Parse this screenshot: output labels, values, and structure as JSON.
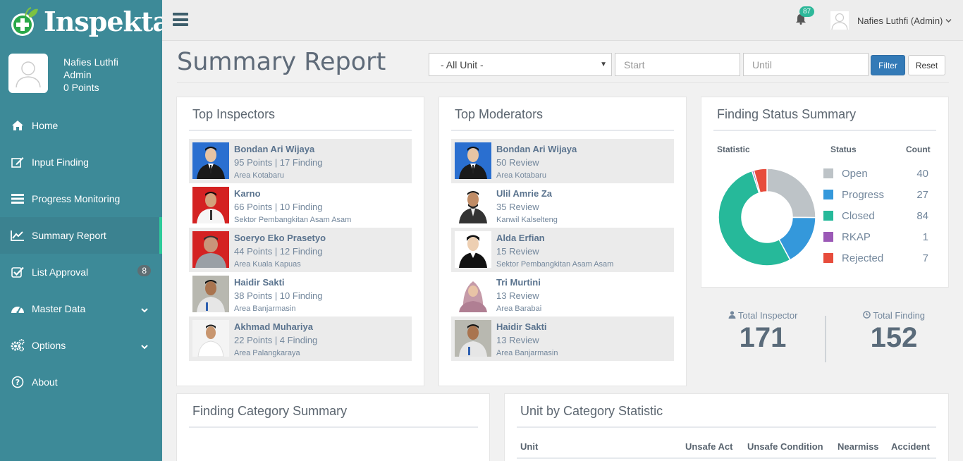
{
  "app": {
    "name": "Inspekta"
  },
  "sidebar": {
    "user_name": "Nafies Luthfi",
    "user_role": "Admin",
    "user_points": "0 Points",
    "items": [
      {
        "label": "Home",
        "icon": "home-icon"
      },
      {
        "label": "Input Finding",
        "icon": "edit-icon"
      },
      {
        "label": "Progress Monitoring",
        "icon": "list-icon"
      },
      {
        "label": "Summary Report",
        "icon": "line-chart-icon",
        "active": true
      },
      {
        "label": "List Approval",
        "icon": "check-square-icon",
        "badge": "8"
      },
      {
        "label": "Master Data",
        "icon": "dashboard-icon",
        "expandable": true
      },
      {
        "label": "Options",
        "icon": "gears-icon",
        "expandable": true
      },
      {
        "label": "About",
        "icon": "question-circle-icon"
      }
    ]
  },
  "topbar": {
    "notifications": "87",
    "user": "Nafies Luthfi (Admin)"
  },
  "page": {
    "title": "Summary Report",
    "unit_select": "- All Unit -",
    "start_placeholder": "Start",
    "until_placeholder": "Until",
    "filter_label": "Filter",
    "reset_label": "Reset"
  },
  "top_inspectors": {
    "title": "Top Inspectors",
    "items": [
      {
        "name": "Bondan Ari Wijaya",
        "score": "95 Points | 17 Finding",
        "area": "Area Kotabaru"
      },
      {
        "name": "Karno",
        "score": "66 Points | 10 Finding",
        "area": "Sektor Pembangkitan Asam Asam"
      },
      {
        "name": "Soeryo Eko Prasetyo",
        "score": "44 Points | 12 Finding",
        "area": "Area Kuala Kapuas"
      },
      {
        "name": "Haidir Sakti",
        "score": "38 Points | 10 Finding",
        "area": "Area Banjarmasin"
      },
      {
        "name": "Akhmad Muhariya",
        "score": "22 Points | 4 Finding",
        "area": "Area Palangkaraya"
      }
    ]
  },
  "top_moderators": {
    "title": "Top Moderators",
    "items": [
      {
        "name": "Bondan Ari Wijaya",
        "score": "50 Review",
        "area": "Area Kotabaru"
      },
      {
        "name": "Ulil Amrie Za",
        "score": "35 Review",
        "area": "Kanwil Kalselteng"
      },
      {
        "name": "Alda Erfian",
        "score": "15 Review",
        "area": "Sektor Pembangkitan Asam Asam"
      },
      {
        "name": "Tri Murtini",
        "score": "13 Review",
        "area": "Area Barabai"
      },
      {
        "name": "Haidir Sakti",
        "score": "13 Review",
        "area": "Area Banjarmasin"
      }
    ]
  },
  "finding_status": {
    "title": "Finding Status Summary",
    "col_statistic": "Statistic",
    "col_status": "Status",
    "col_count": "Count"
  },
  "chart_data": {
    "type": "pie",
    "categories": [
      "Open",
      "Progress",
      "Closed",
      "RKAP",
      "Rejected"
    ],
    "values": [
      40,
      27,
      84,
      1,
      7
    ],
    "colors": [
      "#bdc3c7",
      "#3498db",
      "#26b99a",
      "#9b59b6",
      "#e74c3c"
    ],
    "donut": true
  },
  "totals": {
    "inspector_label": "Total Inspector",
    "inspector_value": "171",
    "finding_label": "Total Finding",
    "finding_value": "152"
  },
  "category_summary": {
    "title": "Finding Category Summary"
  },
  "unit_category": {
    "title": "Unit by Category Statistic",
    "columns": [
      "Unit",
      "Unsafe Act",
      "Unsafe Condition",
      "Nearmiss",
      "Accident"
    ]
  }
}
